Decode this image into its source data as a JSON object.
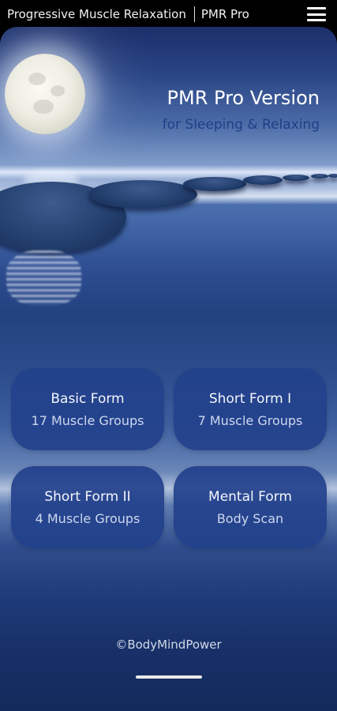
{
  "app_bar": {
    "title": "Progressive Muscle Relaxation",
    "subtitle": "PMR Pro",
    "menu_icon": "hamburger-menu-icon"
  },
  "hero": {
    "title": "PMR Pro Version",
    "subtitle": "for Sleeping & Relaxing"
  },
  "forms": [
    {
      "title": "Basic Form",
      "detail": "17 Muscle Groups"
    },
    {
      "title": "Short Form I",
      "detail": "7 Muscle Groups"
    },
    {
      "title": "Short Form II",
      "detail": "4 Muscle Groups"
    },
    {
      "title": "Mental Form",
      "detail": "Body Scan"
    }
  ],
  "footer": {
    "copyright": "©BodyMindPower"
  },
  "colors": {
    "card_background": "#23418c",
    "hero_subtitle": "#1f3f86"
  }
}
